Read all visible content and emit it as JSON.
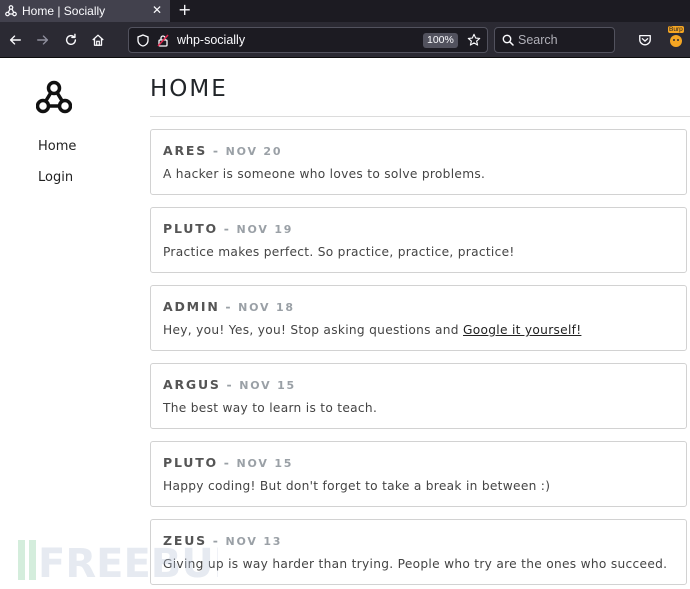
{
  "browser": {
    "tab_title": "Home | Socially",
    "tab_close": "✕",
    "new_tab": "+",
    "url": "whp-socially",
    "zoom": "100%",
    "search_placeholder": "Search",
    "extension_badge": "Burp"
  },
  "sidebar": {
    "items": [
      {
        "label": "Home"
      },
      {
        "label": "Login"
      }
    ]
  },
  "page": {
    "title": "HOME",
    "separator": "-"
  },
  "posts": [
    {
      "author": "ARES",
      "date": "NOV 20",
      "text": "A hacker is someone who loves to solve problems."
    },
    {
      "author": "PLUTO",
      "date": "NOV 19",
      "text": "Practice makes perfect. So practice, practice, practice!"
    },
    {
      "author": "ADMIN",
      "date": "NOV 18",
      "text": "Hey, you! Yes, you! Stop asking questions and ",
      "link": "Google it yourself!"
    },
    {
      "author": "ARGUS",
      "date": "NOV 15",
      "text": "The best way to learn is to teach."
    },
    {
      "author": "PLUTO",
      "date": "NOV 15",
      "text": "Happy coding! But don't forget to take a break in between :)"
    },
    {
      "author": "ZEUS",
      "date": "NOV 13",
      "text": "Giving up is way harder than trying. People who try are the ones who succeed."
    }
  ],
  "watermark": "FREEBUF",
  "colors": {
    "chrome_dark": "#1c1b22",
    "chrome_toolbar": "#2b2a33",
    "post_border": "#d2d2d2",
    "date_gray": "#9aa0a6"
  }
}
